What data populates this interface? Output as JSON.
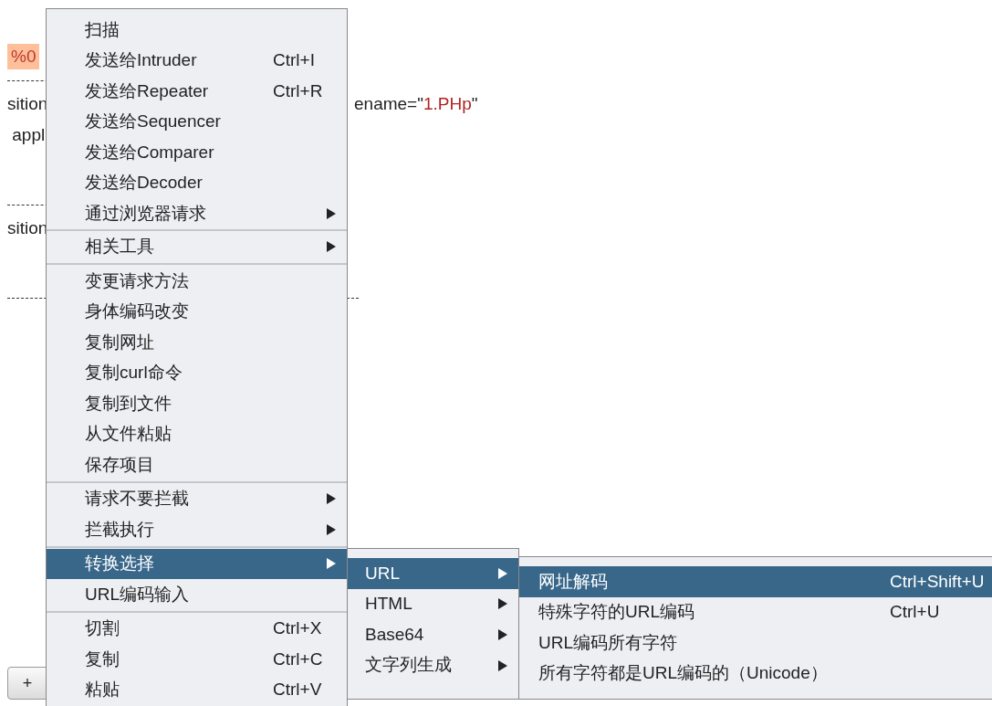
{
  "editor": {
    "lines": [
      {
        "kind": "text",
        "left": [
          {
            "text": "%0",
            "kind": "highlight"
          }
        ]
      },
      {
        "kind": "rule"
      },
      {
        "kind": "text",
        "left": [
          {
            "text": "sition",
            "kind": "text"
          }
        ],
        "right": [
          {
            "text": "ename=",
            "kind": "text"
          },
          {
            "text": "\"",
            "kind": "text"
          },
          {
            "text": "1.PHp",
            "kind": "string"
          },
          {
            "text": "\"",
            "kind": "text"
          }
        ]
      },
      {
        "kind": "text",
        "left": [
          {
            "text": " appl",
            "kind": "text"
          }
        ]
      },
      {
        "kind": "gap"
      },
      {
        "kind": "rule"
      },
      {
        "kind": "text",
        "left": [
          {
            "text": "sition",
            "kind": "text"
          }
        ]
      },
      {
        "kind": "gap"
      },
      {
        "kind": "rule_long"
      }
    ]
  },
  "add_button": {
    "label": "+"
  },
  "context_menu": {
    "sections": [
      [
        {
          "label": "扫描",
          "selected": false,
          "submenu": false
        },
        {
          "label": "发送给Intruder",
          "shortcut": "Ctrl+I",
          "selected": false,
          "submenu": false
        },
        {
          "label": "发送给Repeater",
          "shortcut": "Ctrl+R",
          "selected": false,
          "submenu": false
        },
        {
          "label": "发送给Sequencer",
          "selected": false,
          "submenu": false
        },
        {
          "label": "发送给Comparer",
          "selected": false,
          "submenu": false
        },
        {
          "label": "发送给Decoder",
          "selected": false,
          "submenu": false
        },
        {
          "label": "通过浏览器请求",
          "selected": false,
          "submenu": true
        }
      ],
      [
        {
          "label": "相关工具",
          "selected": false,
          "submenu": true
        }
      ],
      [
        {
          "label": "变更请求方法",
          "selected": false,
          "submenu": false
        },
        {
          "label": "身体编码改变",
          "selected": false,
          "submenu": false
        },
        {
          "label": "复制网址",
          "selected": false,
          "submenu": false
        },
        {
          "label": "复制curl命令",
          "selected": false,
          "submenu": false
        },
        {
          "label": "复制到文件",
          "selected": false,
          "submenu": false
        },
        {
          "label": "从文件粘贴",
          "selected": false,
          "submenu": false
        },
        {
          "label": "保存项目",
          "selected": false,
          "submenu": false
        }
      ],
      [
        {
          "label": "请求不要拦截",
          "selected": false,
          "submenu": true
        },
        {
          "label": "拦截执行",
          "selected": false,
          "submenu": true
        }
      ],
      [
        {
          "label": "转换选择",
          "selected": true,
          "submenu": true
        },
        {
          "label": "URL编码输入",
          "selected": false,
          "submenu": false
        }
      ],
      [
        {
          "label": "切割",
          "shortcut": "Ctrl+X",
          "selected": false,
          "submenu": false
        },
        {
          "label": "复制",
          "shortcut": "Ctrl+C",
          "selected": false,
          "submenu": false
        },
        {
          "label": "粘贴",
          "shortcut": "Ctrl+V",
          "selected": false,
          "submenu": false
        }
      ]
    ]
  },
  "convert_submenu": {
    "items": [
      {
        "label": "URL",
        "selected": true,
        "submenu": true
      },
      {
        "label": "HTML",
        "selected": false,
        "submenu": true
      },
      {
        "label": "Base64",
        "selected": false,
        "submenu": true
      },
      {
        "label": "文字列生成",
        "selected": false,
        "submenu": true
      }
    ]
  },
  "url_submenu": {
    "items": [
      {
        "label": "网址解码",
        "shortcut": "Ctrl+Shift+U",
        "selected": true,
        "submenu": false
      },
      {
        "label": "特殊字符的URL编码",
        "shortcut": "Ctrl+U",
        "selected": false,
        "submenu": false
      },
      {
        "label": "URL编码所有字符",
        "selected": false,
        "submenu": false
      },
      {
        "label": "所有字符都是URL编码的（Unicode）",
        "selected": false,
        "submenu": false
      }
    ]
  }
}
